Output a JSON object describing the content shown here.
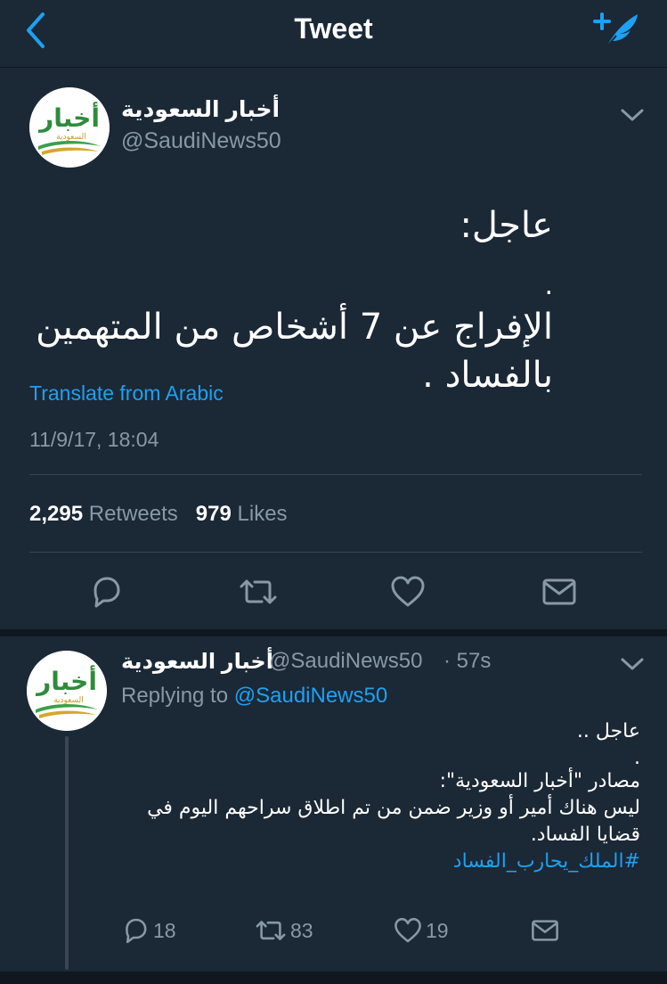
{
  "nav": {
    "title": "Tweet",
    "back_icon": "chevron-left-icon",
    "compose_icon": "compose-tweet-icon",
    "accent": "#1da1f2"
  },
  "tweet": {
    "author_name": "أخبار السعودية",
    "author_handle": "@SaudiNews50",
    "avatar_text": "أخبار",
    "avatar_subtext": "السعودية",
    "body_line1": "عاجل:",
    "body_line2": ".",
    "body_line3": "الإفراج عن 7 أشخاص من المتهمين بالفساد .",
    "translate_label": "Translate from Arabic",
    "timestamp": "11/9/17, 18:04",
    "retweets_count": "2,295",
    "retweets_label": "Retweets",
    "likes_count": "979",
    "likes_label": "Likes"
  },
  "reply": {
    "author_name": "أخبار السعودية",
    "author_handle": "@SaudiNews50",
    "time": "· 57s",
    "replying_label": "Replying to",
    "replying_handle": "@SaudiNews50",
    "body_line1": "عاجل ..",
    "body_line2": ".",
    "body_line3": "مصادر \"أخبار السعودية\":",
    "body_line4": "ليس هناك أمير أو وزير ضمن من تم اطلاق سراحهم اليوم في",
    "body_line5": "قضايا الفساد.",
    "hashtag": "#الملك_يحارب_الفساد",
    "reply_count": "18",
    "retweet_count": "83",
    "like_count": "19"
  },
  "colors": {
    "background": "#1b2836",
    "secondary_text": "#8899a6",
    "link": "#1da1f2",
    "divider": "#38444d"
  }
}
